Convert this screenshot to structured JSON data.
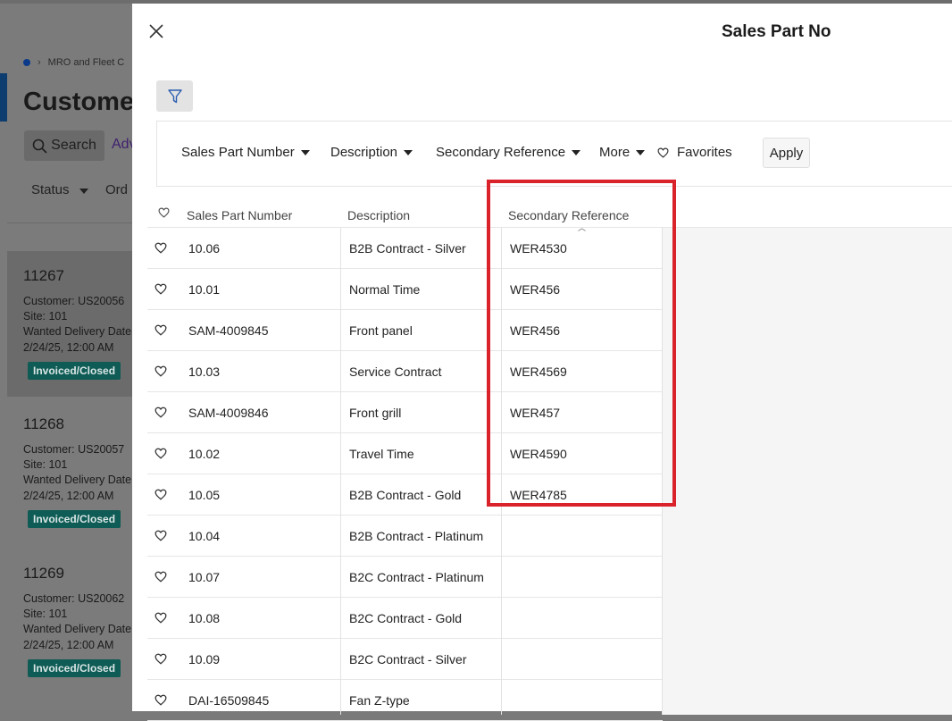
{
  "background": {
    "breadcrumb": "MRO and Fleet C",
    "page_title": "Custome",
    "search_label": "Search",
    "advanced_label": "Adv",
    "status_filter": "Status",
    "order_filter": "Ord",
    "cards": [
      {
        "order_no": "11267",
        "customer": "Customer:  US20056",
        "site": "Site:  101",
        "wanted": "Wanted Delivery Date",
        "date": "2/24/25, 12:00 AM",
        "badge": "Invoiced/Closed",
        "selected": true
      },
      {
        "order_no": "11268",
        "customer": "Customer:  US20057",
        "site": "Site:  101",
        "wanted": "Wanted Delivery Date",
        "date": "2/24/25, 12:00 AM",
        "badge": "Invoiced/Closed",
        "selected": false
      },
      {
        "order_no": "11269",
        "customer": "Customer:  US20062",
        "site": "Site:  101",
        "wanted": "Wanted Delivery Date",
        "date": "2/24/25, 12:00 AM",
        "badge": "Invoiced/Closed",
        "selected": false
      }
    ]
  },
  "panel": {
    "title": "Sales Part No",
    "filters": {
      "sales_part_number": "Sales Part Number",
      "description": "Description",
      "secondary_reference": "Secondary Reference",
      "more": "More",
      "favorites": "Favorites",
      "apply": "Apply"
    },
    "columns": {
      "sales_part_number": "Sales Part Number",
      "description": "Description",
      "secondary_reference": "Secondary Reference"
    },
    "rows": [
      {
        "part": "10.06",
        "desc": "B2B Contract - Silver",
        "ref": "WER4530"
      },
      {
        "part": "10.01",
        "desc": "Normal Time",
        "ref": "WER456"
      },
      {
        "part": "SAM-4009845",
        "desc": "Front panel",
        "ref": "WER456"
      },
      {
        "part": "10.03",
        "desc": "Service Contract",
        "ref": "WER4569"
      },
      {
        "part": "SAM-4009846",
        "desc": "Front grill",
        "ref": "WER457"
      },
      {
        "part": "10.02",
        "desc": "Travel Time",
        "ref": "WER4590"
      },
      {
        "part": "10.05",
        "desc": "B2B Contract - Gold",
        "ref": "WER4785"
      },
      {
        "part": "10.04",
        "desc": "B2B Contract - Platinum",
        "ref": ""
      },
      {
        "part": "10.07",
        "desc": "B2C Contract - Platinum",
        "ref": ""
      },
      {
        "part": "10.08",
        "desc": "B2C Contract - Gold",
        "ref": ""
      },
      {
        "part": "10.09",
        "desc": "B2C Contract - Silver",
        "ref": ""
      },
      {
        "part": "DAI-16509845",
        "desc": "Fan Z-type",
        "ref": ""
      }
    ]
  },
  "colors": {
    "highlight": "#d9222a",
    "badge_bg": "#0f5b55",
    "overlay": "#7b7b7b"
  }
}
